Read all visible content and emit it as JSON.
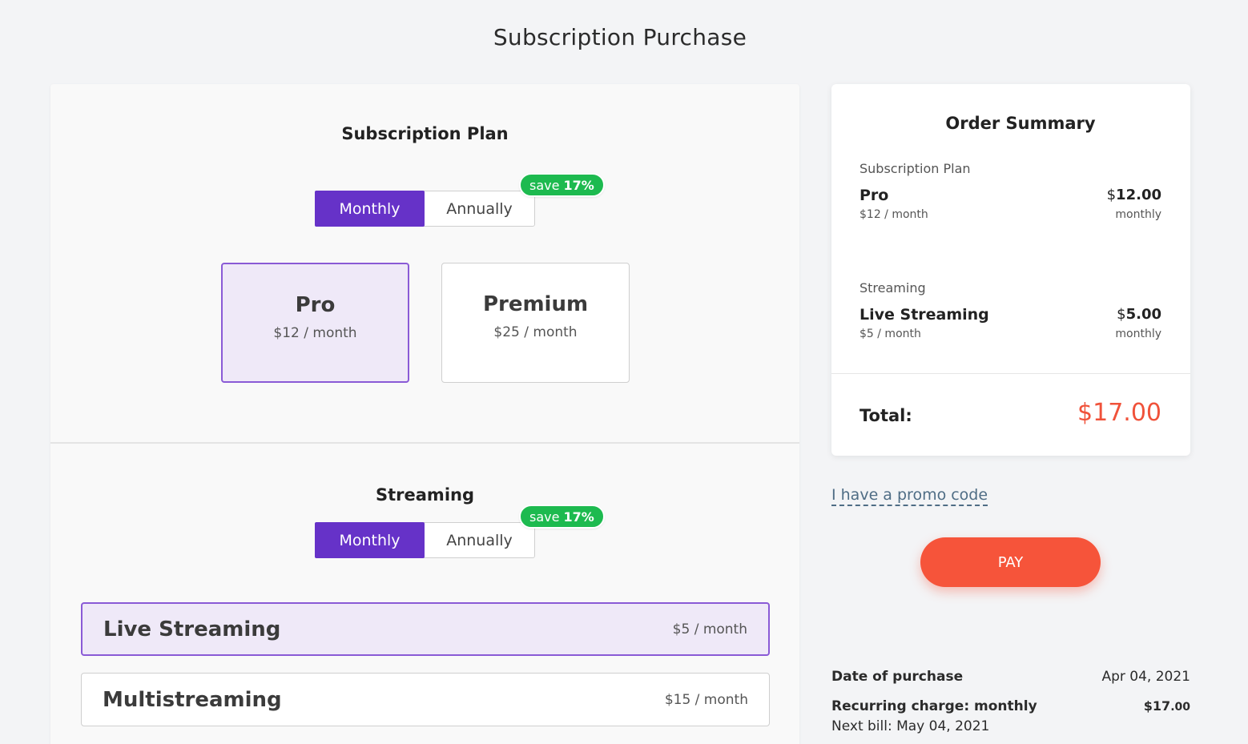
{
  "page": {
    "title": "Subscription Purchase"
  },
  "subscription_plan": {
    "title": "Subscription Plan",
    "toggle": {
      "monthly": "Monthly",
      "annually": "Annually",
      "selected": "Monthly"
    },
    "badge": {
      "prefix": "save",
      "value": "17%"
    },
    "plans": [
      {
        "name": "Pro",
        "price": "$12 / month",
        "selected": true
      },
      {
        "name": "Premium",
        "price": "$25 / month",
        "selected": false
      }
    ]
  },
  "streaming": {
    "title": "Streaming",
    "toggle": {
      "monthly": "Monthly",
      "annually": "Annually",
      "selected": "Monthly"
    },
    "badge": {
      "prefix": "save",
      "value": "17%"
    },
    "options": [
      {
        "name": "Live Streaming",
        "price": "$5 / month",
        "selected": true
      },
      {
        "name": "Multistreaming",
        "price": "$15 / month",
        "selected": false
      }
    ]
  },
  "summary": {
    "title": "Order Summary",
    "items": [
      {
        "category": "Subscription Plan",
        "name": "Pro",
        "sub": "$12 / month",
        "amount_symbol": "$",
        "amount_main": "12",
        "amount_cents": ".00",
        "freq": "monthly"
      },
      {
        "category": "Streaming",
        "name": "Live Streaming",
        "sub": "$5 / month",
        "amount_symbol": "$",
        "amount_main": "5",
        "amount_cents": ".00",
        "freq": "monthly"
      }
    ],
    "total_label": "Total:",
    "total_value": "$17.00"
  },
  "promo": {
    "label": "I have a promo code"
  },
  "pay": {
    "label": "PAY"
  },
  "info": {
    "date_label": "Date of purchase",
    "date_value": "Apr 04, 2021",
    "recurring_label": "Recurring charge: monthly",
    "recurring_main": "$17",
    "recurring_cents": ".00",
    "next_bill": "Next bill: May 04, 2021"
  },
  "colors": {
    "accent": "#6632c8",
    "selected_bg": "#efe9f8",
    "badge_green": "#1dba4f",
    "pay_orange": "#f6543a",
    "total_red": "#f0523a"
  }
}
